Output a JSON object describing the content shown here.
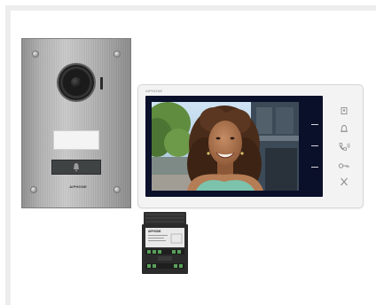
{
  "door_station": {
    "brand": "AIPHONE"
  },
  "monitor": {
    "brand": "AIPHONE"
  },
  "power_supply": {
    "brand": "AIPHONE"
  },
  "colors": {
    "frame": "#ededed",
    "panel_steel": "#b2b2b2",
    "monitor_body": "#f3f3f3",
    "screen_bezel": "#0a0f2a",
    "psu_body": "#2b2b2b"
  },
  "icons": [
    "bell-icon",
    "camera-icon",
    "monitor-icon",
    "handset-icon",
    "key-icon",
    "close-icon"
  ]
}
